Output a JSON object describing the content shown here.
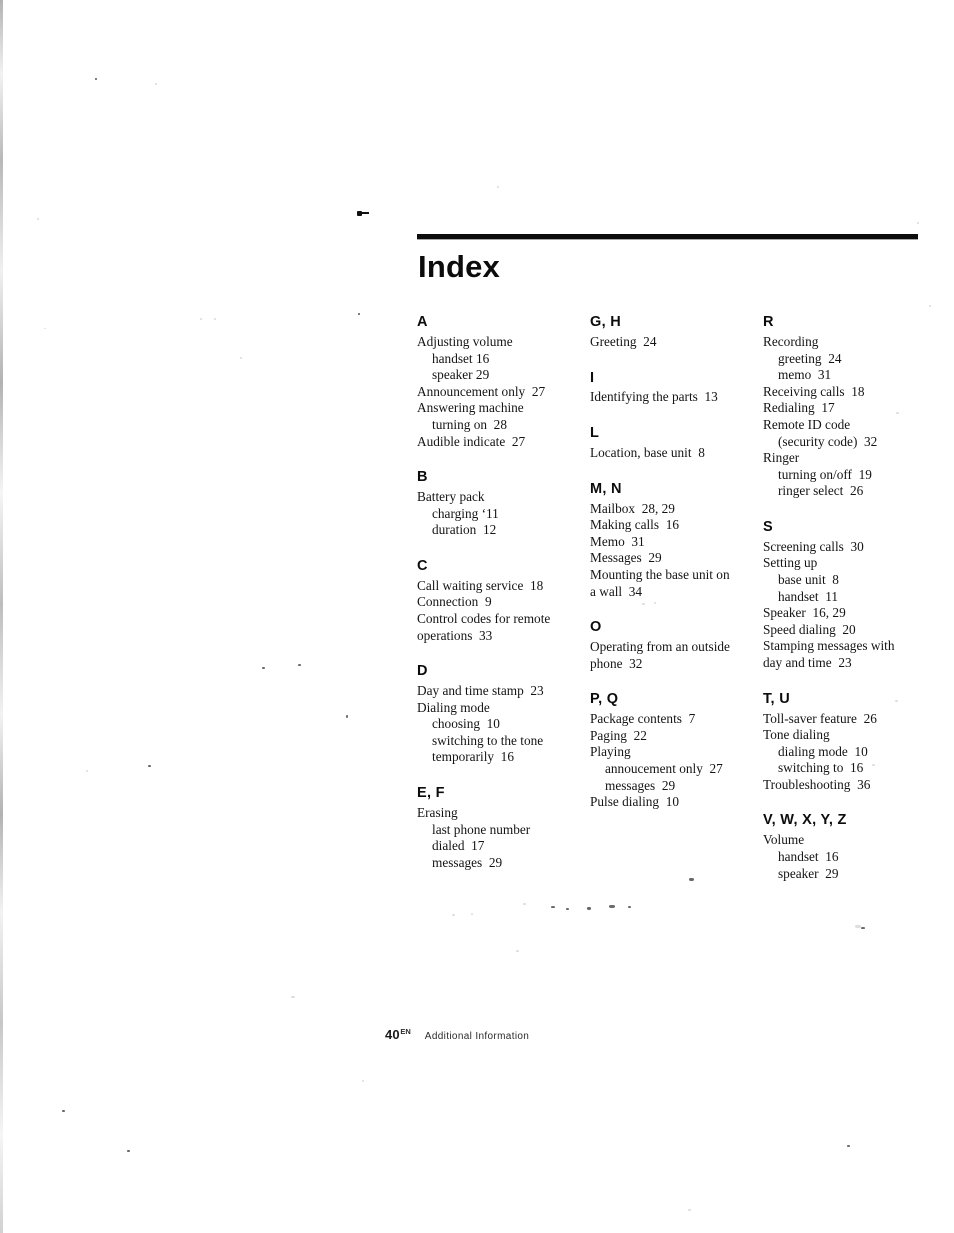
{
  "page": {
    "title": "Index",
    "footer": {
      "page_number": "40",
      "page_suffix": "EN",
      "section": "Additional Information"
    }
  },
  "columns": [
    {
      "id": "column-1",
      "groups": [
        {
          "letter": "A",
          "entries": [
            {
              "text": "Adjusting volume",
              "level": 0
            },
            {
              "text": "handset 16",
              "level": 1
            },
            {
              "text": "speaker 29",
              "level": 1
            },
            {
              "text": "Announcement only  27",
              "level": 0
            },
            {
              "text": "Answering machine",
              "level": 0
            },
            {
              "text": "turning on  28",
              "level": 1
            },
            {
              "text": "Audible indicate  27",
              "level": 0
            }
          ]
        },
        {
          "letter": "B",
          "entries": [
            {
              "text": "Battery pack",
              "level": 0
            },
            {
              "text": "charging ‘11",
              "level": 1
            },
            {
              "text": "duration  12",
              "level": 1
            }
          ]
        },
        {
          "letter": "C",
          "entries": [
            {
              "text": "Call waiting service  18",
              "level": 0
            },
            {
              "text": "Connection  9",
              "level": 0
            },
            {
              "text": "Control codes for remote",
              "level": 0
            },
            {
              "text": "operations  33",
              "level": 0
            }
          ]
        },
        {
          "letter": "D",
          "entries": [
            {
              "text": "Day and time stamp  23",
              "level": 0
            },
            {
              "text": "Dialing mode",
              "level": 0
            },
            {
              "text": "choosing  10",
              "level": 1
            },
            {
              "text": "switching to the tone",
              "level": 1
            },
            {
              "text": "temporarily  16",
              "level": 1
            }
          ]
        },
        {
          "letter": "E, F",
          "entries": [
            {
              "text": "Erasing",
              "level": 0
            },
            {
              "text": "last phone number",
              "level": 1
            },
            {
              "text": "dialed  17",
              "level": 1
            },
            {
              "text": "messages  29",
              "level": 1
            }
          ]
        }
      ]
    },
    {
      "id": "column-2",
      "groups": [
        {
          "letter": "G, H",
          "entries": [
            {
              "text": "Greeting  24",
              "level": 0
            }
          ]
        },
        {
          "letter": "I",
          "entries": [
            {
              "text": "Identifying the parts  13",
              "level": 0
            }
          ]
        },
        {
          "letter": "L",
          "entries": [
            {
              "text": "Location, base unit  8",
              "level": 0
            }
          ]
        },
        {
          "letter": "M, N",
          "entries": [
            {
              "text": "Mailbox  28, 29",
              "level": 0
            },
            {
              "text": "Making calls  16",
              "level": 0
            },
            {
              "text": "Memo  31",
              "level": 0
            },
            {
              "text": "Messages  29",
              "level": 0
            },
            {
              "text": "Mounting the base unit on",
              "level": 0
            },
            {
              "text": "a wall  34",
              "level": 0
            }
          ]
        },
        {
          "letter": "O",
          "entries": [
            {
              "text": "Operating from an outside",
              "level": 0
            },
            {
              "text": "phone  32",
              "level": 0
            }
          ]
        },
        {
          "letter": "P, Q",
          "entries": [
            {
              "text": "Package contents  7",
              "level": 0
            },
            {
              "text": "Paging  22",
              "level": 0
            },
            {
              "text": "Playing",
              "level": 0
            },
            {
              "text": "annoucement only  27",
              "level": 1
            },
            {
              "text": "messages  29",
              "level": 1
            },
            {
              "text": "Pulse dialing  10",
              "level": 0
            }
          ]
        }
      ]
    },
    {
      "id": "column-3",
      "groups": [
        {
          "letter": "R",
          "entries": [
            {
              "text": "Recording",
              "level": 0
            },
            {
              "text": "greeting  24",
              "level": 1
            },
            {
              "text": "memo  31",
              "level": 1
            },
            {
              "text": "Receiving calls  18",
              "level": 0
            },
            {
              "text": "Redialing  17",
              "level": 0
            },
            {
              "text": "Remote ID code",
              "level": 0
            },
            {
              "text": "(security code)  32",
              "level": 1
            },
            {
              "text": "Ringer",
              "level": 0
            },
            {
              "text": "turning on/off  19",
              "level": 1
            },
            {
              "text": "ringer select  26",
              "level": 1
            }
          ]
        },
        {
          "letter": "S",
          "entries": [
            {
              "text": "Screening calls  30",
              "level": 0
            },
            {
              "text": "Setting up",
              "level": 0
            },
            {
              "text": "base unit  8",
              "level": 1
            },
            {
              "text": "handset  11",
              "level": 1
            },
            {
              "text": "Speaker  16, 29",
              "level": 0
            },
            {
              "text": "Speed dialing  20",
              "level": 0
            },
            {
              "text": "Stamping messages with",
              "level": 0
            },
            {
              "text": "day and time  23",
              "level": 0
            }
          ]
        },
        {
          "letter": "T, U",
          "entries": [
            {
              "text": "Toll-saver feature  26",
              "level": 0
            },
            {
              "text": "Tone dialing",
              "level": 0
            },
            {
              "text": "dialing mode  10",
              "level": 1
            },
            {
              "text": "switching to  16",
              "level": 1
            },
            {
              "text": "Troubleshooting  36",
              "level": 0
            }
          ]
        },
        {
          "letter": "V, W, X, Y, Z",
          "entries": [
            {
              "text": "Volume",
              "level": 0
            },
            {
              "text": "handset  16",
              "level": 1
            },
            {
              "text": "speaker  29",
              "level": 1
            }
          ]
        }
      ]
    }
  ]
}
